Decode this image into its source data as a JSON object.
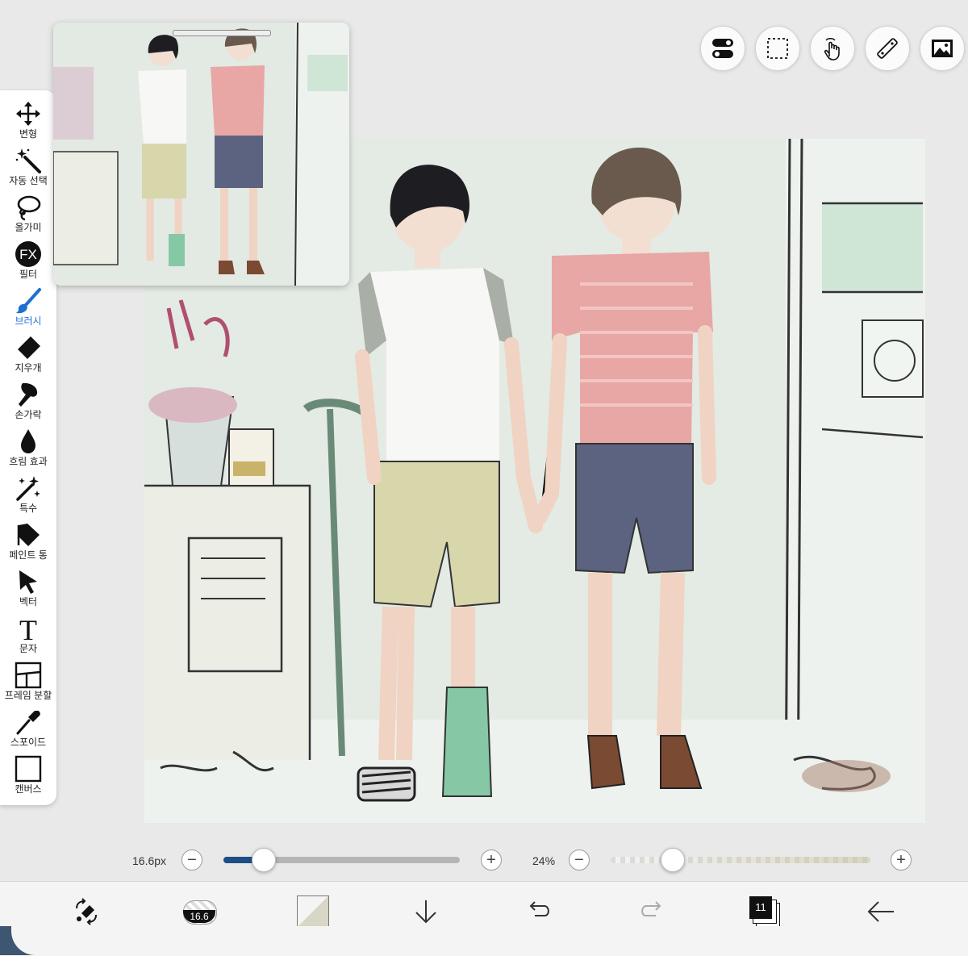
{
  "tools": [
    {
      "id": "transform",
      "label": "변형",
      "icon": "move-icon"
    },
    {
      "id": "auto_select",
      "label": "자동 선택",
      "icon": "magic-wand-icon"
    },
    {
      "id": "lasso",
      "label": "올가미",
      "icon": "lasso-icon"
    },
    {
      "id": "filter",
      "label": "필터",
      "icon": "fx-icon"
    },
    {
      "id": "brush",
      "label": "브러시",
      "icon": "brush-icon",
      "active": true
    },
    {
      "id": "eraser",
      "label": "지우개",
      "icon": "eraser-icon"
    },
    {
      "id": "smudge",
      "label": "손가락",
      "icon": "finger-icon"
    },
    {
      "id": "blur",
      "label": "흐림 효과",
      "icon": "drop-icon"
    },
    {
      "id": "special",
      "label": "특수",
      "icon": "sparkle-wand-icon"
    },
    {
      "id": "fill",
      "label": "페인트 통",
      "icon": "paint-bucket-icon"
    },
    {
      "id": "vector",
      "label": "벡터",
      "icon": "cursor-arrow-icon"
    },
    {
      "id": "text",
      "label": "문자",
      "icon": "text-icon"
    },
    {
      "id": "frame",
      "label": "프레임 분할",
      "icon": "frame-divide-icon"
    },
    {
      "id": "eyedropper",
      "label": "스포이드",
      "icon": "eyedropper-icon"
    },
    {
      "id": "canvas",
      "label": "캔버스",
      "icon": "canvas-icon"
    }
  ],
  "top_buttons": [
    "toggle-icon",
    "selection-icon",
    "hand-gesture-icon",
    "ruler-icon",
    "image-icon"
  ],
  "brush_size": {
    "label": "16.6px",
    "level": 0.17
  },
  "opacity": {
    "label": "24%",
    "level": 0.24
  },
  "bottom_bar": {
    "brush_size_badge": "16.6",
    "layer_count": "11"
  },
  "colors": {
    "accent": "#1f6fd1",
    "size_track": "#1d4f86",
    "shirt_pink": "#e8a7a4",
    "shorts_navy": "#5c6380",
    "shorts_khaki": "#d8d6ab",
    "cast_green": "#86c8a6"
  }
}
